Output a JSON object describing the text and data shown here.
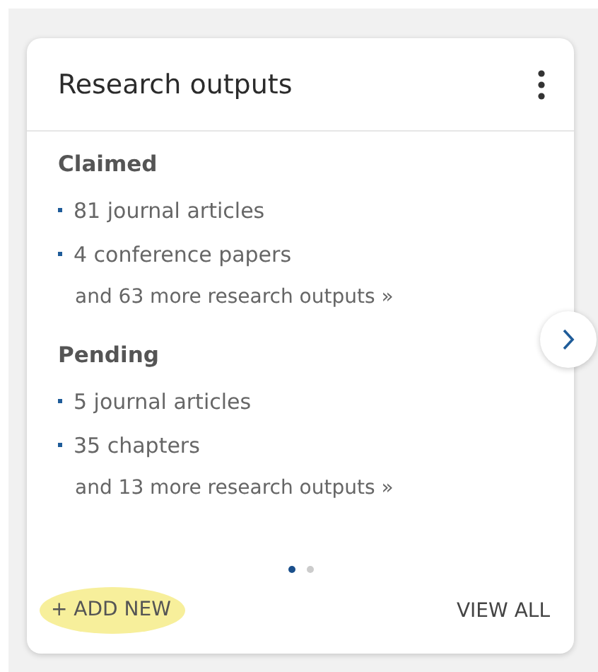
{
  "card": {
    "title": "Research outputs",
    "sections": [
      {
        "heading": "Claimed",
        "items": [
          "81 journal articles",
          "4 conference papers"
        ],
        "more": "and 63 more research outputs »"
      },
      {
        "heading": "Pending",
        "items": [
          "5 journal articles",
          "35 chapters"
        ],
        "more": "and 13 more research outputs »"
      }
    ],
    "pages": [
      {
        "selected": true
      },
      {
        "selected": false
      }
    ],
    "add_button": {
      "label": "+ ADD NEW",
      "highlighted": true
    },
    "view_all": "VIEW ALL"
  }
}
